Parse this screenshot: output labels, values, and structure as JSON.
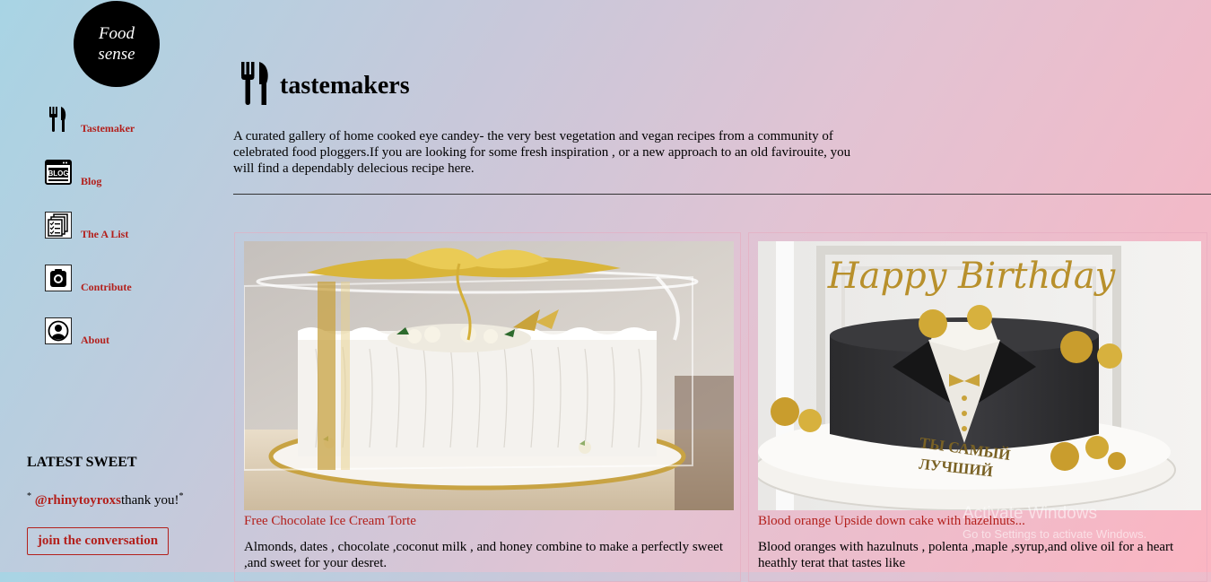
{
  "brand": {
    "line1": "Food",
    "line2": "sense"
  },
  "nav": {
    "items": [
      {
        "label": "Tastemaker",
        "icon": "fork-knife-icon"
      },
      {
        "label": "Blog",
        "icon": "blog-icon"
      },
      {
        "label": "The A List",
        "icon": "checklist-icon"
      },
      {
        "label": "Contribute",
        "icon": "camera-icon"
      },
      {
        "label": "About",
        "icon": "user-icon"
      }
    ],
    "blog_icon_text": "BLOG"
  },
  "latest": {
    "title": "LATEST SWEET",
    "mark_open": "*",
    "mention": "@rhinytoyroxs",
    "message": "thank you!",
    "mark_close": "*",
    "join_label": "join the conversation"
  },
  "page": {
    "title": "tastemakers",
    "intro": "A curated gallery of home cooked eye candey- the very best vegetation and vegan recipes from a community of celebrated food ploggers.If you are looking for some fresh inspiration , or a new approach to an old favirouite, you will find a dependably delecious recipe here."
  },
  "cards": [
    {
      "title": "Free Chocolate Ice Cream Torte",
      "desc": "Almonds, dates , chocolate ,coconut milk , and honey combine to make a perfectly sweet ,and sweet for your desret."
    },
    {
      "title": "Blood orange Upside down cake with hazelnuts...",
      "desc": "Blood oranges with hazulnuts , polenta ,maple ,syrup,and olive oil for a heart heathly terat that tastes like",
      "topper_text": "Happy Birthday",
      "base_text_1": "ТЫ САМЫЙ",
      "base_text_2": "ЛУЧШИЙ"
    }
  ],
  "system": {
    "watermark_line1": "Activate Windows",
    "watermark_line2": "Go to Settings to activate Windows."
  },
  "colors": {
    "accent": "#b3201c",
    "logo_bg": "#000000"
  }
}
